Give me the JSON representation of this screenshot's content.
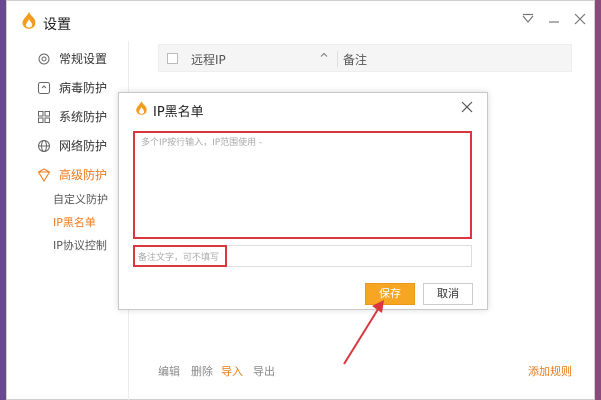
{
  "window": {
    "title": "设置",
    "icons": [
      "app-logo-icon",
      "dropdown-icon",
      "minimize-icon",
      "close-icon"
    ]
  },
  "sidebar": {
    "items": [
      {
        "label": "常规设置",
        "icon": "gear-icon"
      },
      {
        "label": "病毒防护",
        "icon": "virus-shield-icon"
      },
      {
        "label": "系统防护",
        "icon": "system-grid-icon"
      },
      {
        "label": "网络防护",
        "icon": "globe-icon"
      },
      {
        "label": "高级防护",
        "icon": "advanced-shield-icon"
      }
    ],
    "subitems": [
      {
        "label": "自定义防护"
      },
      {
        "label": "IP黑名单"
      },
      {
        "label": "IP协议控制"
      }
    ]
  },
  "table": {
    "col_ip": "远程IP",
    "col_note": "备注"
  },
  "bottom_bar": {
    "edit": "编辑",
    "delete": "删除",
    "import": "导入",
    "export": "导出",
    "add_rule": "添加规则"
  },
  "dialog": {
    "title": "IP黑名单",
    "textarea_placeholder": "多个IP按行输入，IP范围使用 -",
    "note_placeholder": "备注文字，可不填写",
    "save": "保存",
    "cancel": "取消"
  },
  "colors": {
    "accent": "#f07a1a",
    "highlight_red": "#d9363e",
    "save_button": "#f6a623"
  }
}
